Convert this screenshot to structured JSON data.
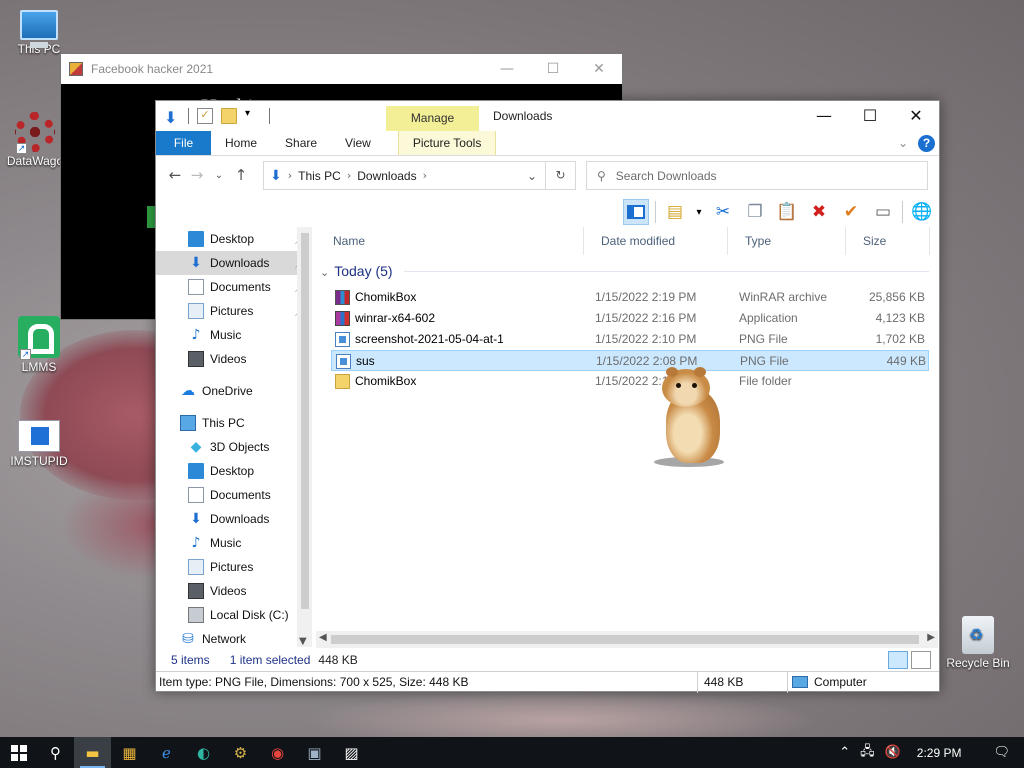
{
  "desktop": {
    "icons": [
      {
        "label": "This PC"
      },
      {
        "label": "DataWago"
      },
      {
        "label": "LMMS"
      },
      {
        "label": "IMSTUPID"
      },
      {
        "label": "Recycle Bin"
      }
    ]
  },
  "background_window": {
    "title": "Facebook hacker 2021",
    "body_text": "Hacking ___ ___ ___ ___"
  },
  "explorer": {
    "title": "Downloads",
    "context_tab": "Manage",
    "ribbon_tabs": [
      "File",
      "Home",
      "Share",
      "View",
      "Picture Tools"
    ],
    "window_controls": {
      "minimize": "—",
      "maximize": "☐",
      "close": "✕"
    },
    "address": {
      "crumbs": [
        "This PC",
        "Downloads"
      ]
    },
    "search_placeholder": "Search Downloads",
    "nav_items": [
      {
        "label": "Desktop",
        "icon": "desktop-icon",
        "pinned": true
      },
      {
        "label": "Downloads",
        "icon": "downloads-icon",
        "pinned": true,
        "selected": true
      },
      {
        "label": "Documents",
        "icon": "documents-icon",
        "pinned": true
      },
      {
        "label": "Pictures",
        "icon": "pictures-icon",
        "pinned": true
      },
      {
        "label": "Music",
        "icon": "music-icon"
      },
      {
        "label": "Videos",
        "icon": "videos-icon"
      },
      {
        "label": "OneDrive",
        "icon": "onedrive-icon"
      },
      {
        "label": "This PC",
        "icon": "this-pc-icon"
      },
      {
        "label": "3D Objects",
        "icon": "3d-objects-icon"
      },
      {
        "label": "Desktop",
        "icon": "desktop-icon"
      },
      {
        "label": "Documents",
        "icon": "documents-icon"
      },
      {
        "label": "Downloads",
        "icon": "downloads-icon"
      },
      {
        "label": "Music",
        "icon": "music-icon"
      },
      {
        "label": "Pictures",
        "icon": "pictures-icon"
      },
      {
        "label": "Videos",
        "icon": "videos-icon"
      },
      {
        "label": "Local Disk (C:)",
        "icon": "local-disk-icon"
      },
      {
        "label": "Network",
        "icon": "network-icon"
      }
    ],
    "columns": [
      "Name",
      "Date modified",
      "Type",
      "Size"
    ],
    "group": "Today (5)",
    "files": [
      {
        "name": "ChomikBox",
        "date": "1/15/2022 2:19 PM",
        "type": "WinRAR archive",
        "size": "25,856 KB",
        "icon": "winrar-icon"
      },
      {
        "name": "winrar-x64-602",
        "date": "1/15/2022 2:16 PM",
        "type": "Application",
        "size": "4,123 KB",
        "icon": "installer-icon"
      },
      {
        "name": "screenshot-2021-05-04-at-11.39",
        "date": "1/15/2022 2:10 PM",
        "type": "PNG File",
        "size": "1,702 KB",
        "icon": "png-file-icon"
      },
      {
        "name": "sus",
        "date": "1/15/2022 2:08 PM",
        "type": "PNG File",
        "size": "449 KB",
        "icon": "png-file-icon",
        "selected": true
      },
      {
        "name": "ChomikBox",
        "date": "1/15/2022 2:19 PM",
        "type": "File folder",
        "size": "",
        "icon": "folder-icon"
      }
    ],
    "status": {
      "items": "5 items",
      "selected": "1 item selected",
      "selected_size": "448 KB"
    },
    "details": {
      "info": "Item type: PNG File, Dimensions: 700 x 525, Size: 448 KB",
      "size": "448 KB",
      "location": "Computer"
    }
  },
  "taskbar": {
    "clock": "2:29 PM"
  }
}
